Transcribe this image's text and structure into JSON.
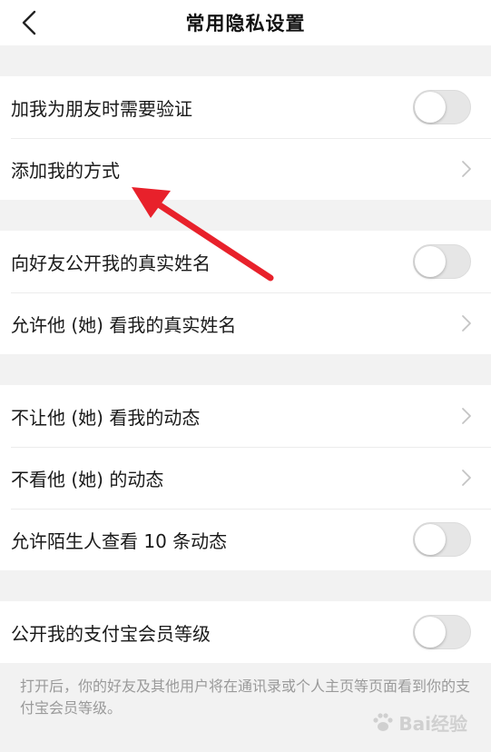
{
  "header": {
    "title": "常用隐私设置"
  },
  "groups": [
    {
      "items": [
        {
          "label": "加我为朋友时需要验证",
          "type": "toggle"
        },
        {
          "label": "添加我的方式",
          "type": "link"
        }
      ]
    },
    {
      "items": [
        {
          "label": "向好友公开我的真实姓名",
          "type": "toggle"
        },
        {
          "label": "允许他 (她) 看我的真实姓名",
          "type": "link"
        }
      ]
    },
    {
      "items": [
        {
          "label": "不让他 (她) 看我的动态",
          "type": "link"
        },
        {
          "label": "不看他 (她) 的动态",
          "type": "link"
        },
        {
          "label": "允许陌生人查看 10 条动态",
          "type": "toggle"
        }
      ]
    },
    {
      "items": [
        {
          "label": "公开我的支付宝会员等级",
          "type": "toggle"
        }
      ]
    }
  ],
  "description": "打开后，你的好友及其他用户将在通讯录或个人主页等页面看到你的支付宝会员等级。",
  "annotation": {
    "color": "#e8212b"
  },
  "watermark": {
    "text": "Bai经验"
  },
  "colors": {
    "toggle_off": "#e6e6e6",
    "chevron": "#c4c4c4",
    "separator": "#ececec"
  }
}
